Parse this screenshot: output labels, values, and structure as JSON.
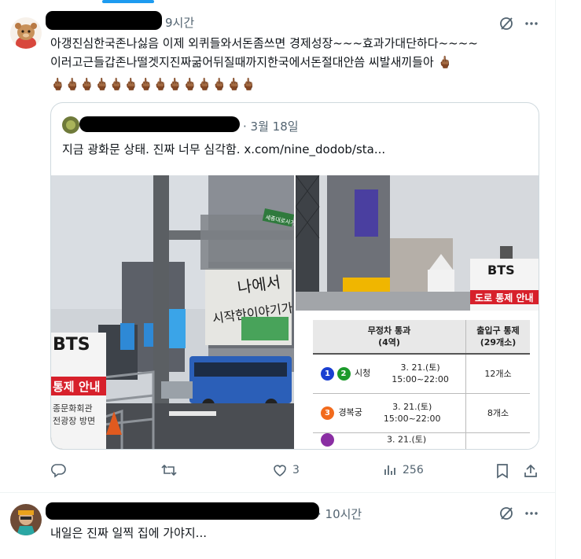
{
  "post1": {
    "time": "9시간",
    "line1": "아갱진심한국존나싫음 이제 외퀴들와서돈좀쓰면 경제성장~~~효과가대단하다~~~~",
    "line2": "이러고근들갑존나떨겟지진짜굶어뒤질때까지한국에서돈절대안씀 씨발새끼들아 🖕🏾",
    "emoji_row": "🖕🏾🖕🏾🖕🏾🖕🏾🖕🏾🖕🏾🖕🏾🖕🏾🖕🏾🖕🏾🖕🏾🖕🏾🖕🏾🖕🏾",
    "actions": {
      "replies": "",
      "reposts": "",
      "likes": "3",
      "views": "256"
    },
    "quote": {
      "date": "· 3월 18일",
      "text": "지금 광화문 상태. 진짜 너무 심각함.  x.com/nine_dodob/sta...",
      "photo_left": {
        "billboard": "나에서\n시작한이야기가",
        "street_sign": "세종대로사거리",
        "banner_bts": "BTS",
        "banner_notice": "통제 안내",
        "banner_bottom": "종문화회관\n전광장 방면"
      },
      "photo_right": {
        "banner_bts": "BTS",
        "banner_notice": "도로 통제 안내"
      },
      "schedule_table": {
        "headers": [
          "무정차 통과\n(4역)",
          "출입구 통제\n(29개소)"
        ],
        "rows": [
          {
            "lines": [
              "1",
              "2"
            ],
            "line_colors": [
              "#1a3fd1",
              "#1c9a2b"
            ],
            "station": "시청",
            "date": "3. 21.(토)",
            "time": "15:00~22:00",
            "count": "12개소"
          },
          {
            "lines": [
              "3"
            ],
            "line_colors": [
              "#f26b1d"
            ],
            "station": "경복궁",
            "date": "3. 21.(토)",
            "time": "15:00~22:00",
            "count": "8개소"
          },
          {
            "lines": [
              ""
            ],
            "line_colors": [
              "#8a2ea3"
            ],
            "station": "",
            "date": "3. 21.(토)",
            "time": "",
            "count": ""
          }
        ]
      }
    }
  },
  "post2": {
    "time": "· 10시간",
    "text": "내일은 진짜 일찍 집에 가야지..."
  },
  "icons": {
    "grok": "grok-icon",
    "more": "more-icon",
    "reply": "reply-icon",
    "repost": "repost-icon",
    "like": "like-icon",
    "views": "views-icon",
    "bookmark": "bookmark-icon",
    "share": "share-icon"
  }
}
